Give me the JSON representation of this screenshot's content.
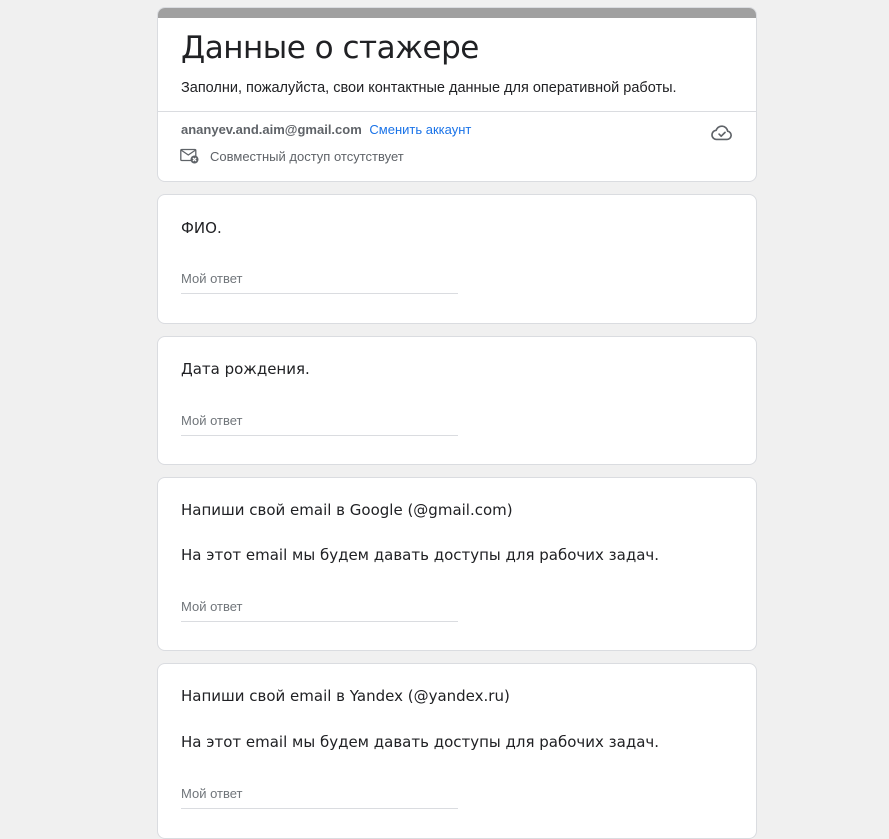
{
  "form": {
    "title": "Данные о стажере",
    "description": "Заполни, пожалуйста, свои контактные данные для оперативной работы.",
    "accent_color": "#a0a0a0"
  },
  "account": {
    "email": "ananyev.and.aim@gmail.com",
    "switch_label": "Сменить аккаунт",
    "sharing_status": "Совместный доступ отсутствует",
    "sharing_icon": "mail-off-icon",
    "save_status_icon": "cloud-done-icon"
  },
  "questions": [
    {
      "title": "ФИО.",
      "subtitle": "",
      "placeholder": "Мой ответ"
    },
    {
      "title": "Дата рождения.",
      "subtitle": "",
      "placeholder": "Мой ответ"
    },
    {
      "title": "Напиши свой email в Google (@gmail.com)",
      "subtitle": "На этот email мы будем давать доступы для рабочих задач.",
      "placeholder": "Мой ответ"
    },
    {
      "title": "Напиши свой email в Yandex (@yandex.ru)",
      "subtitle": "На этот email мы будем давать доступы для рабочих задач.",
      "placeholder": "Мой ответ"
    }
  ]
}
